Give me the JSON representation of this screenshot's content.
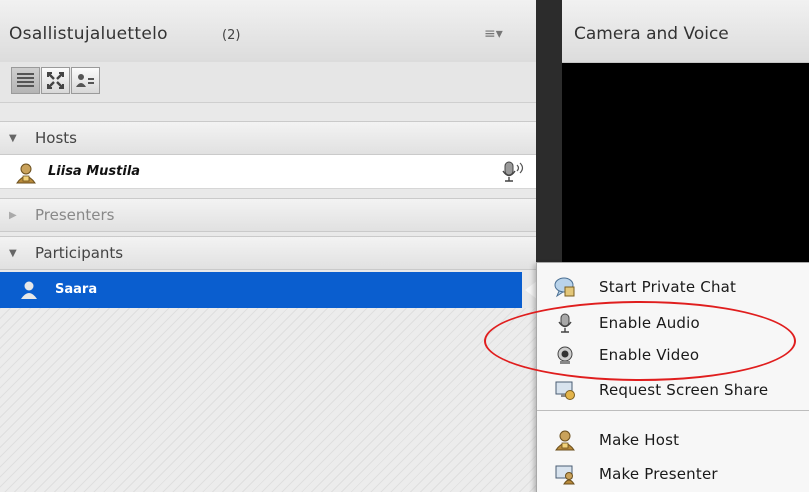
{
  "attendee_pod": {
    "title": "Osallistujaluettelo",
    "count": "(2)",
    "menu_icon": "≡▾",
    "toolbar": [
      "list-view-icon",
      "breakout-icon",
      "status-view-icon"
    ],
    "sections": {
      "hosts": {
        "label": "Hosts",
        "members": [
          {
            "name": "Liisa Mustila",
            "icon": "host-icon",
            "status_icon": "microphone-active-icon"
          }
        ]
      },
      "presenters": {
        "label": "Presenters",
        "members": []
      },
      "participants": {
        "label": "Participants",
        "members": [
          {
            "name": "Saara",
            "icon": "participant-icon",
            "selected": true
          }
        ]
      }
    }
  },
  "camera_pod": {
    "title": "Camera and Voice"
  },
  "context_menu": {
    "items": [
      {
        "label": "Start Private Chat",
        "icon": "chat-bubble-icon"
      },
      {
        "label": "Enable Audio",
        "icon": "microphone-icon"
      },
      {
        "label": "Enable Video",
        "icon": "webcam-icon"
      },
      {
        "label": "Request Screen Share",
        "icon": "screen-share-icon"
      },
      {
        "label": "Make Host",
        "icon": "host-icon"
      },
      {
        "label": "Make Presenter",
        "icon": "presenter-icon"
      }
    ]
  },
  "colors": {
    "selection": "#0a5ecf",
    "highlight_ellipse": "#e01e1e"
  }
}
